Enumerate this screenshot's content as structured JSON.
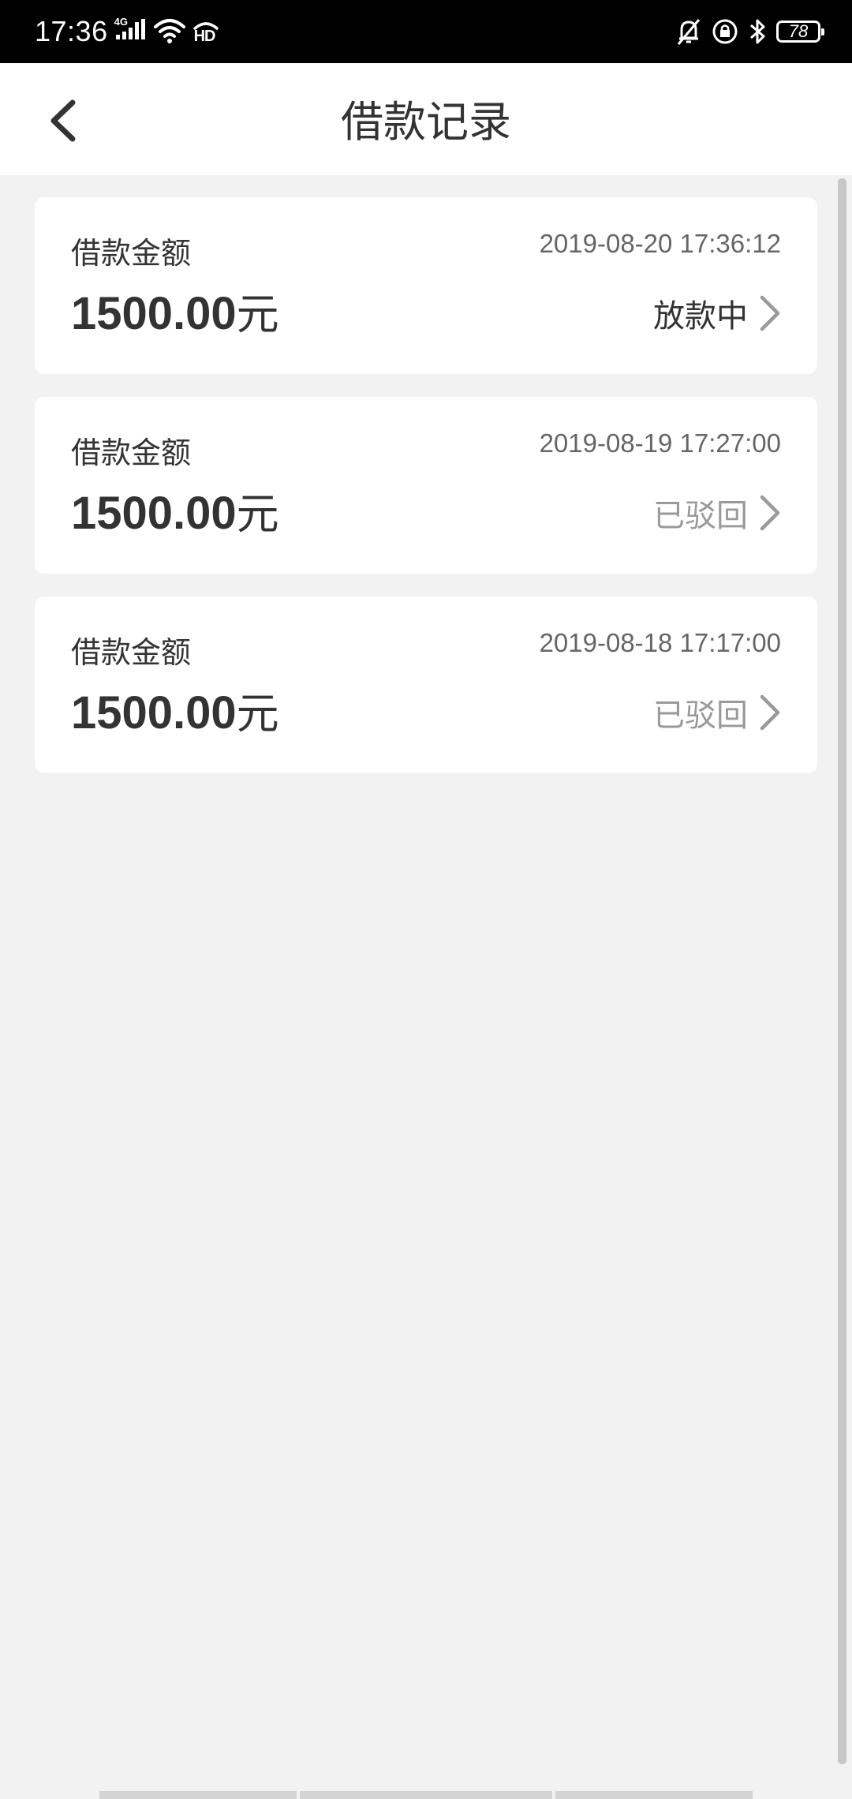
{
  "status_bar": {
    "time": "17:36",
    "network": "4G",
    "hd_label": "HD",
    "battery": "78",
    "icons": [
      "signal-icon",
      "wifi-icon",
      "hd-icon",
      "silent-bell-icon",
      "rotation-lock-icon",
      "bluetooth-icon",
      "battery-icon"
    ]
  },
  "header": {
    "title": "借款记录",
    "back_icon": "chevron-left-icon"
  },
  "records": [
    {
      "label": "借款金额",
      "date": "2019-08-20 17:36:12",
      "amount": "1500.00",
      "unit": "元",
      "status": "放款中",
      "status_color": "#333333"
    },
    {
      "label": "借款金额",
      "date": "2019-08-19 17:27:00",
      "amount": "1500.00",
      "unit": "元",
      "status": "已驳回",
      "status_color": "#9a9a9a"
    },
    {
      "label": "借款金额",
      "date": "2019-08-18 17:17:00",
      "amount": "1500.00",
      "unit": "元",
      "status": "已驳回",
      "status_color": "#9a9a9a"
    }
  ],
  "colors": {
    "background": "#f2f2f2",
    "card": "#ffffff",
    "text_primary": "#333333",
    "text_secondary": "#666666",
    "chevron": "#9a9a9a"
  }
}
